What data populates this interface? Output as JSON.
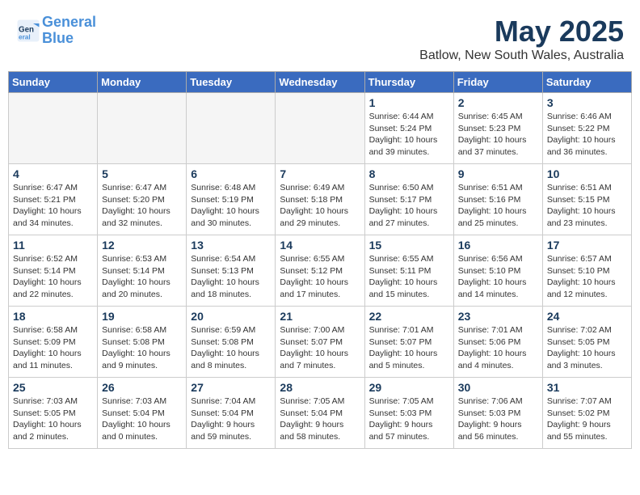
{
  "header": {
    "logo_line1": "General",
    "logo_line2": "Blue",
    "month": "May 2025",
    "location": "Batlow, New South Wales, Australia"
  },
  "weekdays": [
    "Sunday",
    "Monday",
    "Tuesday",
    "Wednesday",
    "Thursday",
    "Friday",
    "Saturday"
  ],
  "weeks": [
    [
      {
        "day": "",
        "info": "",
        "empty": true
      },
      {
        "day": "",
        "info": "",
        "empty": true
      },
      {
        "day": "",
        "info": "",
        "empty": true
      },
      {
        "day": "",
        "info": "",
        "empty": true
      },
      {
        "day": "1",
        "info": "Sunrise: 6:44 AM\nSunset: 5:24 PM\nDaylight: 10 hours\nand 39 minutes.",
        "empty": false
      },
      {
        "day": "2",
        "info": "Sunrise: 6:45 AM\nSunset: 5:23 PM\nDaylight: 10 hours\nand 37 minutes.",
        "empty": false
      },
      {
        "day": "3",
        "info": "Sunrise: 6:46 AM\nSunset: 5:22 PM\nDaylight: 10 hours\nand 36 minutes.",
        "empty": false
      }
    ],
    [
      {
        "day": "4",
        "info": "Sunrise: 6:47 AM\nSunset: 5:21 PM\nDaylight: 10 hours\nand 34 minutes.",
        "empty": false
      },
      {
        "day": "5",
        "info": "Sunrise: 6:47 AM\nSunset: 5:20 PM\nDaylight: 10 hours\nand 32 minutes.",
        "empty": false
      },
      {
        "day": "6",
        "info": "Sunrise: 6:48 AM\nSunset: 5:19 PM\nDaylight: 10 hours\nand 30 minutes.",
        "empty": false
      },
      {
        "day": "7",
        "info": "Sunrise: 6:49 AM\nSunset: 5:18 PM\nDaylight: 10 hours\nand 29 minutes.",
        "empty": false
      },
      {
        "day": "8",
        "info": "Sunrise: 6:50 AM\nSunset: 5:17 PM\nDaylight: 10 hours\nand 27 minutes.",
        "empty": false
      },
      {
        "day": "9",
        "info": "Sunrise: 6:51 AM\nSunset: 5:16 PM\nDaylight: 10 hours\nand 25 minutes.",
        "empty": false
      },
      {
        "day": "10",
        "info": "Sunrise: 6:51 AM\nSunset: 5:15 PM\nDaylight: 10 hours\nand 23 minutes.",
        "empty": false
      }
    ],
    [
      {
        "day": "11",
        "info": "Sunrise: 6:52 AM\nSunset: 5:14 PM\nDaylight: 10 hours\nand 22 minutes.",
        "empty": false
      },
      {
        "day": "12",
        "info": "Sunrise: 6:53 AM\nSunset: 5:14 PM\nDaylight: 10 hours\nand 20 minutes.",
        "empty": false
      },
      {
        "day": "13",
        "info": "Sunrise: 6:54 AM\nSunset: 5:13 PM\nDaylight: 10 hours\nand 18 minutes.",
        "empty": false
      },
      {
        "day": "14",
        "info": "Sunrise: 6:55 AM\nSunset: 5:12 PM\nDaylight: 10 hours\nand 17 minutes.",
        "empty": false
      },
      {
        "day": "15",
        "info": "Sunrise: 6:55 AM\nSunset: 5:11 PM\nDaylight: 10 hours\nand 15 minutes.",
        "empty": false
      },
      {
        "day": "16",
        "info": "Sunrise: 6:56 AM\nSunset: 5:10 PM\nDaylight: 10 hours\nand 14 minutes.",
        "empty": false
      },
      {
        "day": "17",
        "info": "Sunrise: 6:57 AM\nSunset: 5:10 PM\nDaylight: 10 hours\nand 12 minutes.",
        "empty": false
      }
    ],
    [
      {
        "day": "18",
        "info": "Sunrise: 6:58 AM\nSunset: 5:09 PM\nDaylight: 10 hours\nand 11 minutes.",
        "empty": false
      },
      {
        "day": "19",
        "info": "Sunrise: 6:58 AM\nSunset: 5:08 PM\nDaylight: 10 hours\nand 9 minutes.",
        "empty": false
      },
      {
        "day": "20",
        "info": "Sunrise: 6:59 AM\nSunset: 5:08 PM\nDaylight: 10 hours\nand 8 minutes.",
        "empty": false
      },
      {
        "day": "21",
        "info": "Sunrise: 7:00 AM\nSunset: 5:07 PM\nDaylight: 10 hours\nand 7 minutes.",
        "empty": false
      },
      {
        "day": "22",
        "info": "Sunrise: 7:01 AM\nSunset: 5:07 PM\nDaylight: 10 hours\nand 5 minutes.",
        "empty": false
      },
      {
        "day": "23",
        "info": "Sunrise: 7:01 AM\nSunset: 5:06 PM\nDaylight: 10 hours\nand 4 minutes.",
        "empty": false
      },
      {
        "day": "24",
        "info": "Sunrise: 7:02 AM\nSunset: 5:05 PM\nDaylight: 10 hours\nand 3 minutes.",
        "empty": false
      }
    ],
    [
      {
        "day": "25",
        "info": "Sunrise: 7:03 AM\nSunset: 5:05 PM\nDaylight: 10 hours\nand 2 minutes.",
        "empty": false
      },
      {
        "day": "26",
        "info": "Sunrise: 7:03 AM\nSunset: 5:04 PM\nDaylight: 10 hours\nand 0 minutes.",
        "empty": false
      },
      {
        "day": "27",
        "info": "Sunrise: 7:04 AM\nSunset: 5:04 PM\nDaylight: 9 hours\nand 59 minutes.",
        "empty": false
      },
      {
        "day": "28",
        "info": "Sunrise: 7:05 AM\nSunset: 5:04 PM\nDaylight: 9 hours\nand 58 minutes.",
        "empty": false
      },
      {
        "day": "29",
        "info": "Sunrise: 7:05 AM\nSunset: 5:03 PM\nDaylight: 9 hours\nand 57 minutes.",
        "empty": false
      },
      {
        "day": "30",
        "info": "Sunrise: 7:06 AM\nSunset: 5:03 PM\nDaylight: 9 hours\nand 56 minutes.",
        "empty": false
      },
      {
        "day": "31",
        "info": "Sunrise: 7:07 AM\nSunset: 5:02 PM\nDaylight: 9 hours\nand 55 minutes.",
        "empty": false
      }
    ]
  ]
}
